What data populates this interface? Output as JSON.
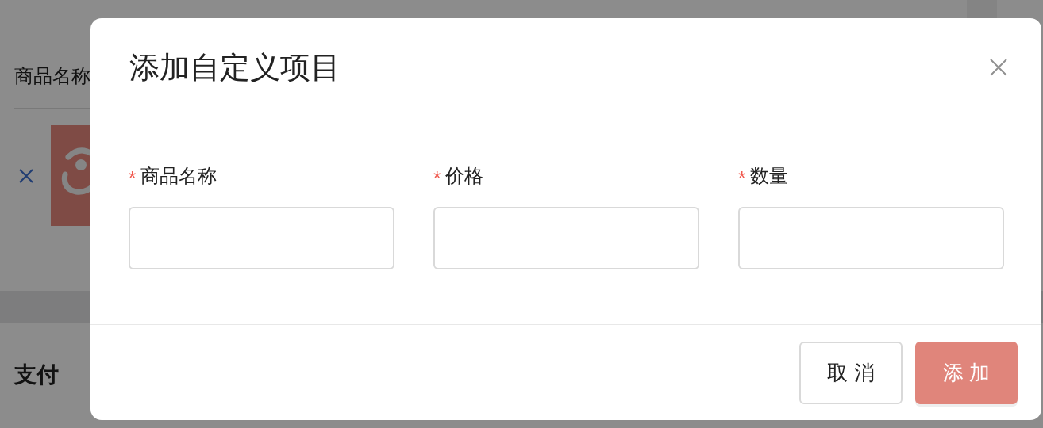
{
  "background": {
    "table_header": "商品名称",
    "section_title": "支付"
  },
  "dialog": {
    "title": "添加自定义项目",
    "fields": [
      {
        "label": "商品名称",
        "required_mark": "*"
      },
      {
        "label": "价格",
        "required_mark": "*"
      },
      {
        "label": "数量",
        "required_mark": "*"
      }
    ],
    "buttons": [
      {
        "label": "取 消",
        "kind": "secondary"
      },
      {
        "label": "添 加",
        "kind": "primary"
      }
    ]
  }
}
